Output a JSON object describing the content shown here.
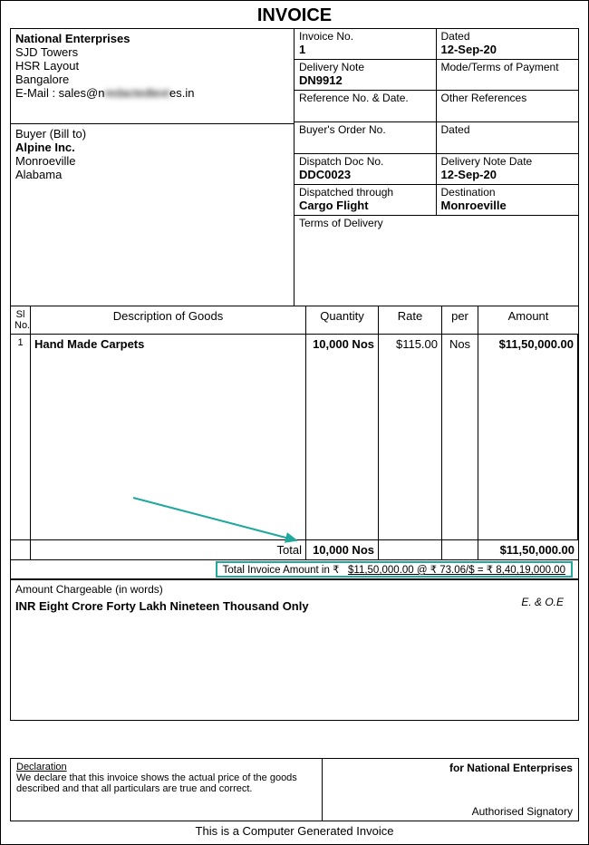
{
  "title": "INVOICE",
  "seller": {
    "name": "National Enterprises",
    "addr1": "SJD Towers",
    "addr2": "HSR Layout",
    "city": "Bangalore",
    "email_prefix": "E-Mail : sales@n",
    "email_mid": "redactedtext",
    "email_suffix": "es.in"
  },
  "buyer": {
    "label": "Buyer (Bill to)",
    "name": "Alpine Inc.",
    "addr1": "Monroeville",
    "addr2": "Alabama"
  },
  "meta": {
    "invoice_no_label": "Invoice No.",
    "invoice_no": "1",
    "dated_label": "Dated",
    "dated": "12-Sep-20",
    "delivery_note_label": "Delivery Note",
    "delivery_note": "DN9912",
    "mode_label": "Mode/Terms of Payment",
    "mode": "",
    "ref_label": "Reference No. & Date.",
    "ref": "",
    "other_ref_label": "Other References",
    "other_ref": "",
    "buyer_order_label": "Buyer's Order No.",
    "buyer_order": "",
    "dated2_label": "Dated",
    "dated2": "",
    "dispatch_doc_label": "Dispatch Doc No.",
    "dispatch_doc": "DDC0023",
    "delivery_note_date_label": "Delivery Note Date",
    "delivery_note_date": "12-Sep-20",
    "dispatched_through_label": "Dispatched through",
    "dispatched_through": "Cargo Flight",
    "destination_label": "Destination",
    "destination": "Monroeville",
    "terms_delivery_label": "Terms of Delivery",
    "terms_delivery": ""
  },
  "items_head": {
    "sl": "Sl No.",
    "desc": "Description of Goods",
    "qty": "Quantity",
    "rate": "Rate",
    "per": "per",
    "amt": "Amount"
  },
  "items": [
    {
      "sl": "1",
      "desc": "Hand Made Carpets",
      "qty": "10,000 Nos",
      "rate": "$115.00",
      "per": "Nos",
      "amt": "$11,50,000.00"
    }
  ],
  "totals": {
    "total_label": "Total",
    "total_qty": "10,000 Nos",
    "total_amt": "$11,50,000.00",
    "conversion_label": "Total Invoice Amount in ₹",
    "conversion_value": "$11,50,000.00 @ ₹ 73.06/$ = ₹ 8,40,19,000.00"
  },
  "words": {
    "chargeable_label": "Amount Chargeable (in words)",
    "eoe": "E. & O.E",
    "amount_words": "INR Eight Crore Forty Lakh Nineteen Thousand Only"
  },
  "footer": {
    "decl_label": "Declaration",
    "decl_text": "We declare that this invoice shows the actual price of the goods described and that all particulars are true and correct.",
    "for_label": "for National Enterprises",
    "auth": "Authorised Signatory"
  },
  "generated": "This is a Computer Generated Invoice"
}
